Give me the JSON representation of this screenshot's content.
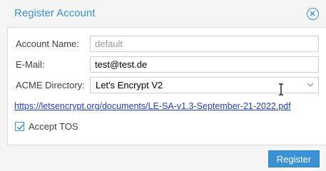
{
  "dialog": {
    "title": "Register Account",
    "close_icon": "close-circle-icon"
  },
  "form": {
    "account_name": {
      "label": "Account Name:",
      "value": "",
      "placeholder": "default"
    },
    "email": {
      "label": "E-Mail:",
      "value": "test@test.de",
      "placeholder": ""
    },
    "acme_directory": {
      "label": "ACME Directory:",
      "value": "Let's Encrypt V2",
      "icon": "chevron-down-icon"
    },
    "tos_link": "https://letsencrypt.org/documents/LE-SA-v1.3-September-21-2022.pdf",
    "accept_tos": {
      "label": "Accept TOS",
      "checked": true,
      "icon": "checkmark-icon"
    }
  },
  "footer": {
    "register_label": "Register"
  },
  "colors": {
    "accent": "#3892d4",
    "link": "#1f3fc2"
  }
}
